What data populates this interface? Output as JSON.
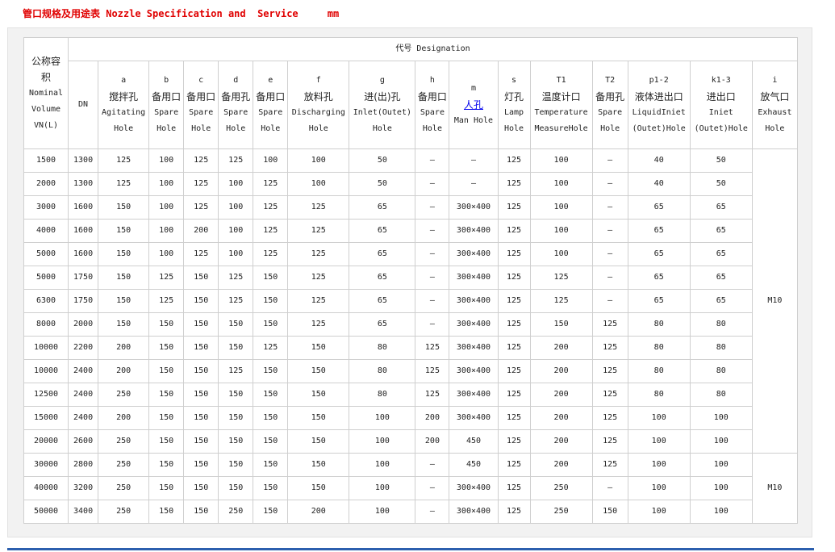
{
  "title": "管口规格及用途表 Nozzle Specification and  Service     mm",
  "header": {
    "nominal_volume": [
      "公称容",
      "积",
      "Nominal",
      "Volume",
      "VN(L)"
    ],
    "designation": "代号 Designation",
    "dn": "DN",
    "columns": [
      {
        "code": "a",
        "cn": "搅拌孔",
        "en": [
          "Agitating",
          "Hole"
        ]
      },
      {
        "code": "b",
        "cn": "备用口",
        "en": [
          "Spare",
          "Hole"
        ]
      },
      {
        "code": "c",
        "cn": "备用口",
        "en": [
          "Spare",
          "Hole"
        ]
      },
      {
        "code": "d",
        "cn": "备用孔",
        "en": [
          "Spare",
          "Hole"
        ]
      },
      {
        "code": "e",
        "cn": "备用口",
        "en": [
          "Spare",
          "Hole"
        ]
      },
      {
        "code": "f",
        "cn": "放料孔",
        "en": [
          "Discharging",
          "Hole"
        ]
      },
      {
        "code": "g",
        "cn": "进(出)孔",
        "en": [
          "Inlet(Outet)",
          "Hole"
        ]
      },
      {
        "code": "h",
        "cn": "备用口",
        "en": [
          "Spare",
          "Hole"
        ]
      },
      {
        "code": "m",
        "cn": "人孔",
        "en": [
          "Man Hole"
        ]
      },
      {
        "code": "s",
        "cn": "灯孔",
        "en": [
          "Lamp",
          "Hole"
        ]
      },
      {
        "code": "T1",
        "cn": "温度计口",
        "en": [
          "Temperature",
          "MeasureHole"
        ]
      },
      {
        "code": "T2",
        "cn": "备用孔",
        "en": [
          "Spare",
          "Hole"
        ]
      },
      {
        "code": "p1-2",
        "cn": "液体进出口",
        "en": [
          "LiquidIniet",
          "(Outet)Hole"
        ]
      },
      {
        "code": "k1-3",
        "cn": "进出口",
        "en": [
          "Iniet",
          "(Outet)Hole"
        ]
      },
      {
        "code": "i",
        "cn": "放气口",
        "en": [
          "Exhaust",
          "Hole"
        ]
      }
    ]
  },
  "rows": [
    [
      "1500",
      "1300",
      "125",
      "100",
      "125",
      "125",
      "100",
      "100",
      "50",
      "–",
      "–",
      "125",
      "100",
      "–",
      "40",
      "50"
    ],
    [
      "2000",
      "1300",
      "125",
      "100",
      "125",
      "100",
      "125",
      "100",
      "50",
      "–",
      "–",
      "125",
      "100",
      "–",
      "40",
      "50"
    ],
    [
      "3000",
      "1600",
      "150",
      "100",
      "125",
      "100",
      "125",
      "125",
      "65",
      "–",
      "300×400",
      "125",
      "100",
      "–",
      "65",
      "65"
    ],
    [
      "4000",
      "1600",
      "150",
      "100",
      "200",
      "100",
      "125",
      "125",
      "65",
      "–",
      "300×400",
      "125",
      "100",
      "–",
      "65",
      "65"
    ],
    [
      "5000",
      "1600",
      "150",
      "100",
      "125",
      "100",
      "125",
      "125",
      "65",
      "–",
      "300×400",
      "125",
      "100",
      "–",
      "65",
      "65"
    ],
    [
      "5000",
      "1750",
      "150",
      "125",
      "150",
      "125",
      "150",
      "125",
      "65",
      "–",
      "300×400",
      "125",
      "125",
      "–",
      "65",
      "65"
    ],
    [
      "6300",
      "1750",
      "150",
      "125",
      "150",
      "125",
      "150",
      "125",
      "65",
      "–",
      "300×400",
      "125",
      "125",
      "–",
      "65",
      "65"
    ],
    [
      "8000",
      "2000",
      "150",
      "150",
      "150",
      "150",
      "150",
      "125",
      "65",
      "–",
      "300×400",
      "125",
      "150",
      "125",
      "80",
      "80"
    ],
    [
      "10000",
      "2200",
      "200",
      "150",
      "150",
      "150",
      "125",
      "150",
      "80",
      "125",
      "300×400",
      "125",
      "200",
      "125",
      "80",
      "80"
    ],
    [
      "10000",
      "2400",
      "200",
      "150",
      "150",
      "125",
      "150",
      "150",
      "80",
      "125",
      "300×400",
      "125",
      "200",
      "125",
      "80",
      "80"
    ],
    [
      "12500",
      "2400",
      "250",
      "150",
      "150",
      "150",
      "150",
      "150",
      "80",
      "125",
      "300×400",
      "125",
      "200",
      "125",
      "80",
      "80"
    ],
    [
      "15000",
      "2400",
      "200",
      "150",
      "150",
      "150",
      "150",
      "150",
      "100",
      "200",
      "300×400",
      "125",
      "200",
      "125",
      "100",
      "100"
    ],
    [
      "20000",
      "2600",
      "250",
      "150",
      "150",
      "150",
      "150",
      "150",
      "100",
      "200",
      "450",
      "125",
      "200",
      "125",
      "100",
      "100"
    ],
    [
      "30000",
      "2800",
      "250",
      "150",
      "150",
      "150",
      "150",
      "150",
      "100",
      "–",
      "450",
      "125",
      "200",
      "125",
      "100",
      "100"
    ],
    [
      "40000",
      "3200",
      "250",
      "150",
      "150",
      "150",
      "150",
      "150",
      "100",
      "–",
      "300×400",
      "125",
      "250",
      "–",
      "100",
      "100"
    ],
    [
      "50000",
      "3400",
      "250",
      "150",
      "150",
      "250",
      "150",
      "200",
      "100",
      "–",
      "300×400",
      "125",
      "250",
      "150",
      "100",
      "100"
    ]
  ],
  "exhaust_groups": [
    {
      "rows": 13,
      "value": "M10"
    },
    {
      "rows": 3,
      "value": "M10"
    }
  ]
}
